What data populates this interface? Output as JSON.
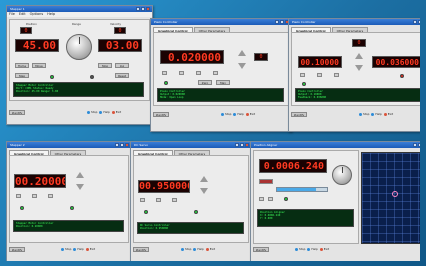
{
  "win1": {
    "title": "Stepper 1",
    "menu": [
      "File",
      "Edit",
      "Options",
      "Help"
    ],
    "lcd_left": "45.00",
    "lcd_right": "03.00",
    "lcd_small_left": "0",
    "lcd_small_right": "0",
    "labels": {
      "top_left": "Position",
      "top_mid": "Range",
      "top_right": "Velocity",
      "btn_a": "Home",
      "btn_b": "Move",
      "btn_c": "Stop",
      "btn_d": "Jog",
      "btn_e": "Step",
      "btn_f": "Reset"
    },
    "status": [
      "Stepper Motor Controller",
      "Port: COM1   Status: Ready",
      "Position: 45.00   Range: 3.00"
    ],
    "footer": {
      "ident": "Identify",
      "stop": "Stop",
      "help": "Help",
      "exit": "Exit"
    }
  },
  "win2": {
    "title": "Piezo Controller",
    "tabs": [
      "Graphical Control",
      "Other Parameters"
    ],
    "lcd_main": "0.020000",
    "lcd_small": "0",
    "btn_zero": "Zero",
    "btn_max": "Max",
    "status": [
      "Piezo Controller",
      "Output: 0.020000",
      "Mode: Open Loop"
    ],
    "footer": {
      "ident": "Identify",
      "stop": "Stop",
      "help": "Help",
      "exit": "Exit"
    }
  },
  "win3": {
    "title": "Piezo Controller",
    "tabs": [
      "Graphical Control",
      "Other Parameters"
    ],
    "lcd_top": "0",
    "lcd_left": "00.10000",
    "lcd_right": "00.036000",
    "status": [
      "Piezo Controller",
      "Output: 0.10000",
      "Feedback: 0.036000"
    ],
    "footer": {
      "ident": "Identify",
      "stop": "Stop",
      "help": "Help",
      "exit": "Exit"
    }
  },
  "win4": {
    "title": "Stepper 2",
    "tabs": [
      "Graphical Control",
      "Other Parameters"
    ],
    "lcd_main": "00.20000",
    "status": [
      "Stepper Motor Controller",
      "Position: 0.20000"
    ],
    "footer": {
      "ident": "Identify",
      "stop": "Stop",
      "help": "Help",
      "exit": "Exit"
    }
  },
  "win5": {
    "title": "DC Servo",
    "tabs": [
      "Graphical Control",
      "Other Parameters"
    ],
    "lcd_main": "00.950000",
    "status": [
      "DC Servo Controller",
      "Position: 0.950000"
    ],
    "footer": {
      "ident": "Identify",
      "stop": "Stop",
      "help": "Help",
      "exit": "Exit"
    }
  },
  "win6": {
    "title": "Position Aligner",
    "lcd_main": "0.0006.240",
    "progress": 0.78,
    "status": [
      "Position Aligner",
      "X: 0.0006.240",
      "Y: 0.000"
    ],
    "footer": {
      "ident": "Identify",
      "stop": "Stop",
      "help": "Help",
      "exit": "Exit"
    }
  },
  "colors": {
    "desktop": "#1f7fb8",
    "lcd_text": "#ff3a22",
    "status_text": "#3eff5b",
    "titlebar": "#1c5bb8"
  }
}
